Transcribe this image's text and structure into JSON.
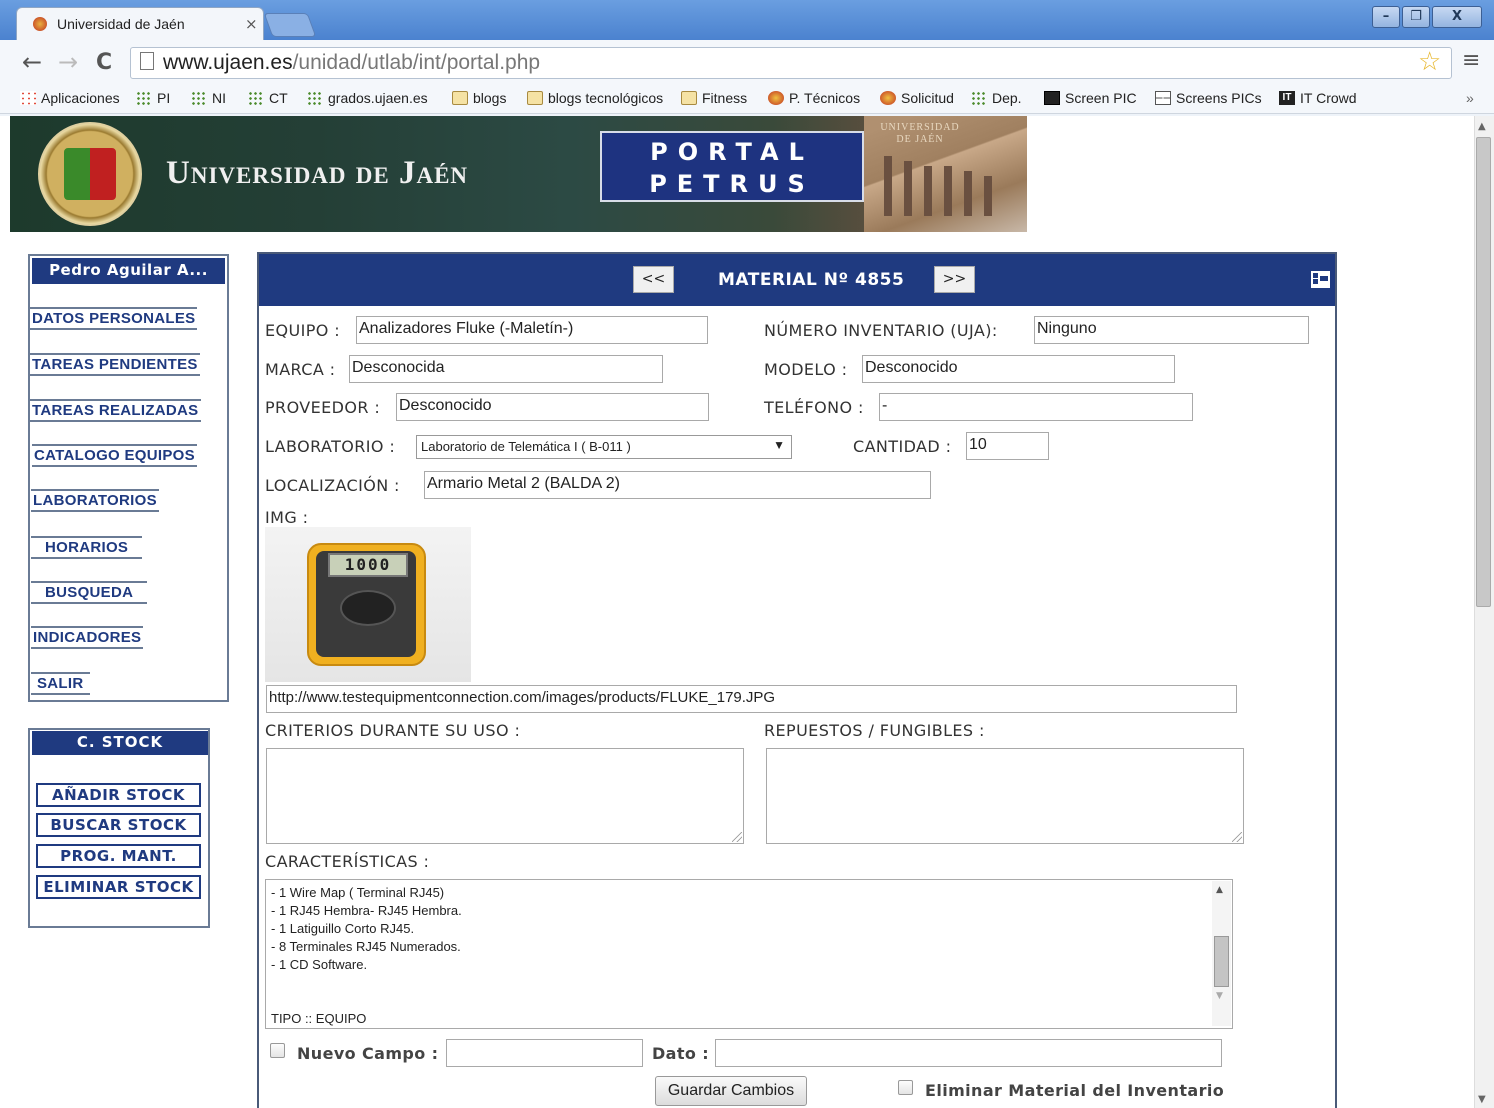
{
  "browser": {
    "tab_title": "Universidad de Jaén",
    "tab_close": "×",
    "url_host": "www.ujaen.es",
    "url_path": "/unidad/utlab/int/portal.php",
    "nav_back": "←",
    "nav_forward": "→",
    "nav_reload": "C",
    "star": "☆",
    "menu": "≡",
    "bookmarks_overflow": "»",
    "window_buttons": [
      "–",
      "❐",
      "X"
    ],
    "bookmarks": [
      {
        "label": "Aplicaciones",
        "icon": "apps-icon"
      },
      {
        "label": "PI",
        "icon": "green-dots-icon"
      },
      {
        "label": "NI",
        "icon": "green-dots-icon"
      },
      {
        "label": "CT",
        "icon": "green-dots-icon"
      },
      {
        "label": "grados.ujaen.es",
        "icon": "green-dots-icon"
      },
      {
        "label": "blogs",
        "icon": "folder-icon"
      },
      {
        "label": "blogs tecnológicos",
        "icon": "folder-icon"
      },
      {
        "label": "Fitness",
        "icon": "folder-icon"
      },
      {
        "label": "P. Técnicos",
        "icon": "ujaen-icon"
      },
      {
        "label": "Solicitud",
        "icon": "ujaen-icon"
      },
      {
        "label": "Dep.",
        "icon": "green-dots-icon"
      },
      {
        "label": "Screen PIC",
        "icon": "picture-icon"
      },
      {
        "label": "Screens PICs",
        "icon": "grid-icon"
      },
      {
        "label": "IT Crowd",
        "icon": "itcrowd-icon"
      }
    ]
  },
  "banner": {
    "university": "Universidad de Jaén",
    "portal_line1": "PORTAL",
    "portal_line2": "PETRUS",
    "building_text": "UNIVERSIDAD DE JAÉN"
  },
  "sidebar": {
    "user": "Pedro Aguilar A...",
    "items": [
      "DATOS PERSONALES",
      "TAREAS PENDIENTES",
      "TAREAS REALIZADAS",
      "CATALOGO EQUIPOS",
      "LABORATORIOS",
      "HORARIOS",
      "BUSQUEDA",
      "INDICADORES",
      "SALIR"
    ],
    "stock_title": "C. STOCK",
    "stock_items": [
      "AÑADIR STOCK",
      "BUSCAR STOCK",
      "PROG. MANT.",
      "ELIMINAR STOCK"
    ]
  },
  "material": {
    "prev": "<<",
    "next": ">>",
    "title": "MATERIAL Nº 4855",
    "fields": {
      "equipo_label": "EQUIPO :",
      "equipo": "Analizadores Fluke (-Maletín-)",
      "inventario_label": "NÚMERO INVENTARIO (UJA):",
      "inventario": "Ninguno",
      "marca_label": "MARCA :",
      "marca": "Desconocida",
      "modelo_label": "MODELO :",
      "modelo": "Desconocido",
      "proveedor_label": "PROVEEDOR :",
      "proveedor": "Desconocido",
      "telefono_label": "TELÉFONO :",
      "telefono": "-",
      "laboratorio_label": "LABORATORIO :",
      "laboratorio": "Laboratorio de Telemática I ( B-011 )",
      "cantidad_label": "CANTIDAD :",
      "cantidad": "10",
      "localizacion_label": "LOCALIZACIÓN :",
      "localizacion": "Armario Metal 2 (BALDA 2)",
      "img_label": "IMG :",
      "img_url": "http://www.testequipmentconnection.com/images/products/FLUKE_179.JPG",
      "meter_display": "1000",
      "criterios_label": "CRITERIOS DURANTE SU USO :",
      "repuestos_label": "REPUESTOS / FUNGIBLES :",
      "caracteristicas_label": "CARACTERÍSTICAS :",
      "caracteristicas_lines": [
        "- 1 Wire Map ( Terminal RJ45)",
        "- 1 RJ45 Hembra- RJ45 Hembra.",
        "- 1 Latiguillo Corto RJ45.",
        "- 8 Terminales RJ45 Numerados.",
        "- 1 CD Software."
      ],
      "tipo": "TIPO :: EQUIPO",
      "nuevo_campo_label": "Nuevo Campo :",
      "dato_label": "Dato :",
      "save": "Guardar Cambios",
      "eliminar_label": "Eliminar Material del Inventario"
    }
  }
}
